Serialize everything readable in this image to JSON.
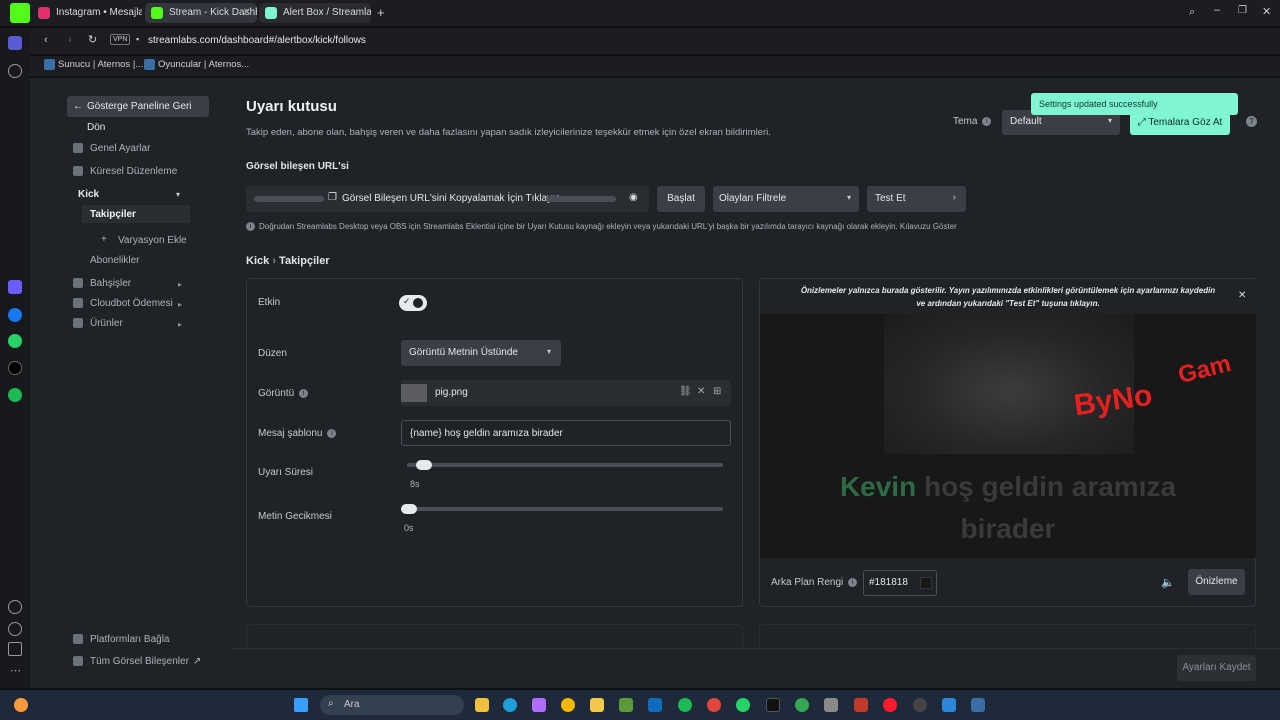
{
  "browser": {
    "tabs": [
      {
        "label": "Instagram • Mesajlar",
        "favicon_color": "#e1306c"
      },
      {
        "label": "Stream - Kick Dashbo",
        "favicon_color": "#53fc18"
      },
      {
        "label": "Alert Box / Streamlabs",
        "favicon_color": "#80f5d2"
      }
    ],
    "url": "streamlabs.com/dashboard#/alertbox/kick/follows",
    "vpn_label": "VPN",
    "bookmarks": [
      "Sunucu | Aternos |...",
      "Oyuncular | Aternos..."
    ]
  },
  "nav": {
    "back_label": "Gösterge Paneline Geri Dön",
    "items": [
      {
        "label": "Genel Ayarlar"
      },
      {
        "label": "Küresel Düzenleme"
      },
      {
        "label": "Kick"
      },
      {
        "label": "Takipçiler"
      },
      {
        "label": "Varyasyon Ekle"
      },
      {
        "label": "Abonelikler"
      },
      {
        "label": "Bahşişler"
      },
      {
        "label": "Cloudbot Ödemesi"
      },
      {
        "label": "Ürünler"
      }
    ],
    "footer": [
      "Platformları Bağla",
      "Tüm Görsel Bileşenler"
    ]
  },
  "header": {
    "title": "Uyarı kutusu",
    "subtitle": "Takip eden, abone olan, bahşiş veren ve daha fazlasını yapan sadık izleyicilerinize teşekkür etmek için özel ekran bildirimleri.",
    "theme_label": "Tema",
    "theme_value": "Default",
    "themes_button": "Temalara Göz At",
    "toast": "Settings updated successfully"
  },
  "widget_url": {
    "label": "Görsel bileşen URL'si",
    "copy_text": "Görsel Bileşen URL'sini Kopyalamak İçin Tıklayın",
    "start_button": "Başlat",
    "filter_label": "Olayları Filtrele",
    "test_label": "Test Et",
    "help_text": "Doğrudan Streamlabs Desktop veya OBS için Streamlabs Eklentisi içine bir Uyarı Kutusu kaynağı ekleyin veya yukarıdaki URL'yi başka bir yazılımda tarayıcı kaynağı olarak ekleyin. Kılavuzu Göster"
  },
  "breadcrumb": {
    "parent": "Kick",
    "sep": "›",
    "current": "Takipçiler"
  },
  "settings": {
    "enabled_label": "Etkin",
    "enabled": true,
    "layout_label": "Düzen",
    "layout_value": "Görüntü Metnin Üstünde",
    "image_label": "Görüntü",
    "image_file": "pig.png",
    "template_label": "Mesaj şablonu",
    "template_value": "{name} hoş geldin aramıza birader",
    "duration_label": "Uyarı Süresi",
    "duration_value": "8s",
    "duration_fraction": 0.03,
    "delay_label": "Metin Gecikmesi",
    "delay_value": "0s",
    "delay_fraction": 0.0
  },
  "preview": {
    "note": "Önizlemeler yalnızca burada gösterilir. Yayın yazılımınızda etkinlikleri görüntülemek için ayarlarınızı kaydedin ve ardından yukarıdaki \"Test Et\" tuşuna tıklayın.",
    "name": "Kevin",
    "message": "hoş geldin aramıza birader",
    "bg_label": "Arka Plan Rengi",
    "bg_value": "#181818",
    "preview_button": "Önizleme"
  },
  "save_button": "Ayarları Kaydet",
  "taskbar": {
    "search_placeholder": "Ara"
  },
  "colors": {
    "accent": "#80f5d2",
    "name_color": "#2e6b45"
  }
}
